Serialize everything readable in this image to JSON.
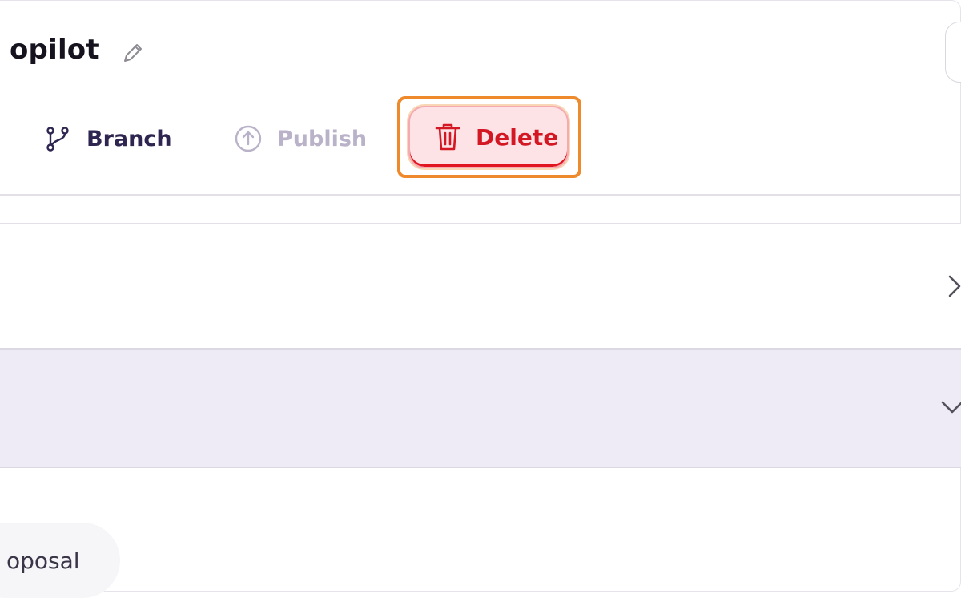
{
  "header": {
    "title": "opilot",
    "edit_icon": "pencil-icon",
    "right_button_icon": "clipboard-icon"
  },
  "toolbar": {
    "branch_label": "Branch",
    "branch_icon": "git-branch-icon",
    "publish_label": "Publish",
    "publish_icon": "upload-circle-icon",
    "delete_label": "Delete",
    "delete_icon": "trash-icon"
  },
  "sections": [
    {
      "icon": "chevron-right-icon",
      "expanded": false
    },
    {
      "icon": "chevron-down-icon",
      "expanded": true
    }
  ],
  "chip": {
    "label": "oposal"
  },
  "colors": {
    "highlight": "#ee8a2c",
    "danger": "#d31723",
    "danger_bg": "#fde3e6",
    "selected_row": "#efebf6",
    "branch_text": "#2e2550",
    "disabled_text": "#b9b2c8"
  }
}
